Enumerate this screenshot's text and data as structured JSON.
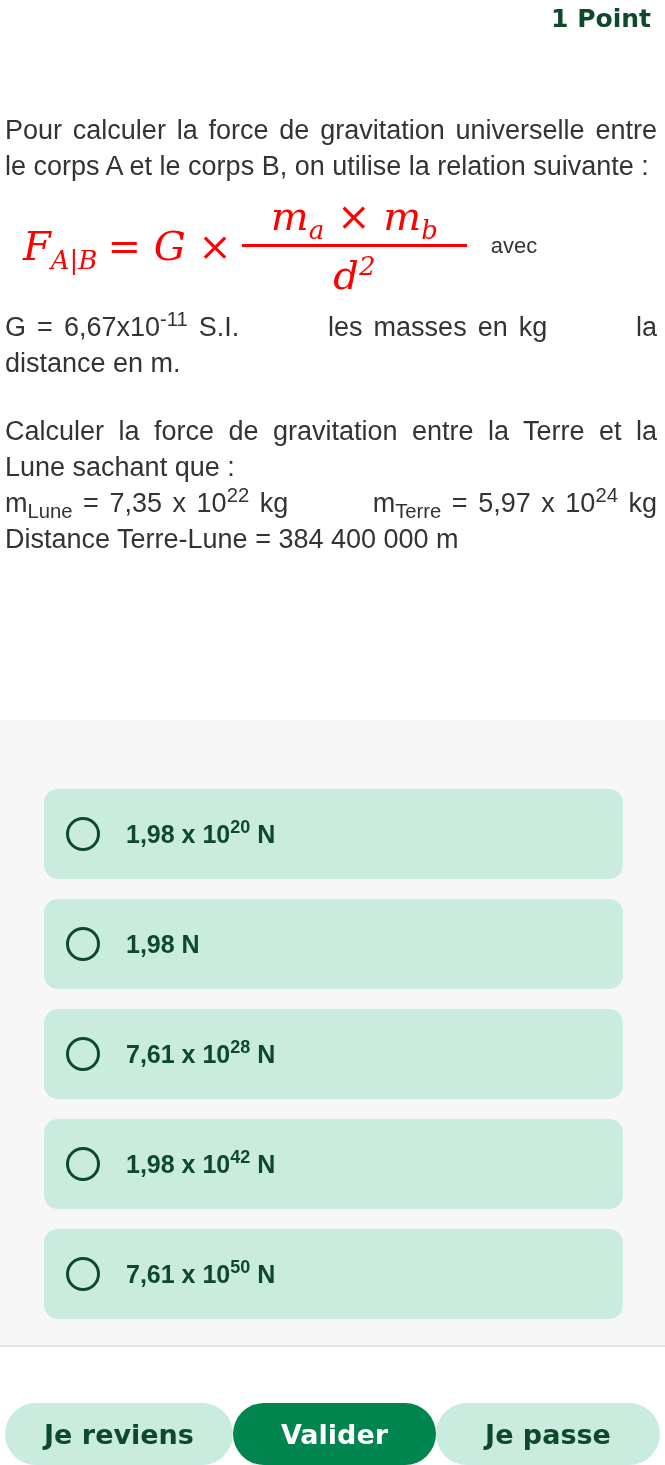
{
  "points": "1 Point",
  "intro": "Pour calculer la force de gravitation universelle entre le corps A et le corps B, on utilise la relation suivante :",
  "formula": {
    "lhs": "F$_{A|B}$",
    "rhs": "= G ×",
    "numerator": "m$_{a}$ × m$_{b}$",
    "denominator": "d$^{2}$",
    "suffix": "avec"
  },
  "paragraphs": [
    "G = 6,67x10$^{-11}$ S.I.        les masses en kg        la distance en m.",
    "Calculer la force de gravitation entre la Terre et la Lune sachant que :",
    "m$_{Lune}$ = 7,35 x 10$^{22}$ kg        m$_{Terre}$ = 5,97 x 10$^{24}$ kg        Distance Terre-Lune = 384 400 000 m"
  ],
  "options": [
    {
      "label": "1,98 x 10$^{20}$ N",
      "selected": false
    },
    {
      "label": "1,98 N",
      "selected": false
    },
    {
      "label": "7,61 x 10$^{28}$ N",
      "selected": false
    },
    {
      "label": "1,98 x 10$^{42}$ N",
      "selected": false
    },
    {
      "label": "7,61 x 10$^{50}$ N",
      "selected": false
    }
  ],
  "buttons": [
    {
      "label": "Je reviens",
      "kind": "secondary"
    },
    {
      "label": "Valider",
      "kind": "primary"
    },
    {
      "label": "Je passe",
      "kind": "secondary"
    }
  ]
}
